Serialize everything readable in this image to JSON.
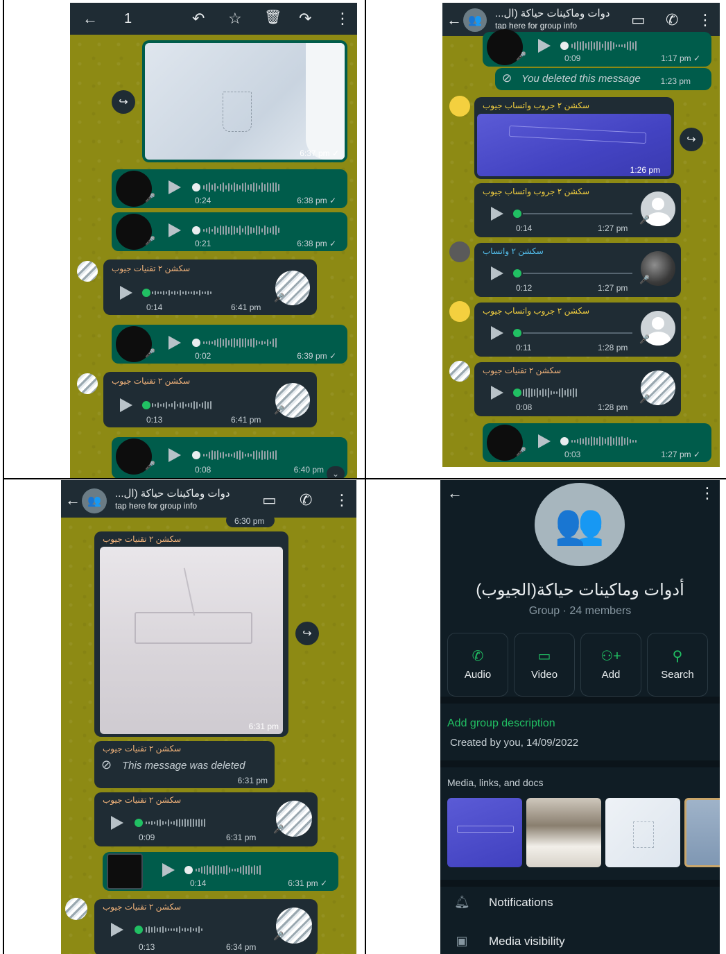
{
  "p1": {
    "toolbar": {
      "count": "1",
      "back_icon": "arrow-left-icon",
      "reply_icon": "reply-icon",
      "star_icon": "star-icon",
      "delete_icon": "trash-icon",
      "forward_icon": "forward-icon",
      "menu_icon": "more-vert-icon"
    },
    "messages": [
      {
        "kind": "image",
        "time": "6:37 pm ✓"
      },
      {
        "kind": "voice",
        "dir": "out",
        "duration": "0:24",
        "time": "6:38 pm ✓"
      },
      {
        "kind": "voice",
        "dir": "out",
        "duration": "0:21",
        "time": "6:38 pm ✓"
      },
      {
        "kind": "voice",
        "dir": "in",
        "sender": "سكشن ٢ تقنيات جيوب",
        "duration": "0:14",
        "time": "6:41 pm"
      },
      {
        "kind": "voice",
        "dir": "out",
        "duration": "0:02",
        "time": "6:39 pm ✓"
      },
      {
        "kind": "voice",
        "dir": "in",
        "sender": "سكشن ٢ تقنيات جيوب",
        "duration": "0:13",
        "time": "6:41 pm"
      },
      {
        "kind": "voice",
        "dir": "out",
        "duration": "0:08",
        "time": "6:40 pm"
      }
    ]
  },
  "p2": {
    "header": {
      "title": "دوات وماكينات حياكة (ال...",
      "subtitle": "tap here for group info"
    },
    "messages": [
      {
        "kind": "voice",
        "dir": "out",
        "duration": "0:09",
        "time": "1:17 pm ✓"
      },
      {
        "kind": "deleted",
        "text": "You deleted this message",
        "time": "1:23 pm"
      },
      {
        "kind": "image",
        "sender": "سكشن ٢ جروب واتساب جيوب",
        "time": "1:26 pm"
      },
      {
        "kind": "voice",
        "dir": "in",
        "sender": "سكشن ٢ جروب واتساب جيوب",
        "duration": "0:14",
        "time": "1:27 pm"
      },
      {
        "kind": "voice",
        "dir": "in",
        "sender": "سكشن ٢ واتساب",
        "duration": "0:12",
        "time": "1:27 pm"
      },
      {
        "kind": "voice",
        "dir": "in",
        "sender": "سكشن ٢ جروب واتساب جيوب",
        "duration": "0:11",
        "time": "1:28 pm"
      },
      {
        "kind": "voice",
        "dir": "in",
        "sender": "سكشن ٢ تقنيات جيوب",
        "duration": "0:08",
        "time": "1:28 pm"
      },
      {
        "kind": "voice",
        "dir": "out",
        "duration": "0:03",
        "time": "1:27 pm ✓"
      }
    ]
  },
  "p3": {
    "header": {
      "title": "دوات وماكينات حياكة (ال...",
      "subtitle": "tap here for group info",
      "top_time": "6:30 pm"
    },
    "messages": [
      {
        "kind": "image",
        "sender": "سكشن ٢ تقنيات جيوب",
        "time": "6:31 pm"
      },
      {
        "kind": "deleted",
        "sender": "سكشن ٢ تقنيات جيوب",
        "text": "This message was deleted",
        "time": "6:31 pm"
      },
      {
        "kind": "voice",
        "dir": "in",
        "sender": "سكشن ٢ تقنيات جيوب",
        "duration": "0:09",
        "time": "6:31 pm"
      },
      {
        "kind": "voice",
        "dir": "out",
        "duration": "0:14",
        "time": "6:31 pm ✓"
      },
      {
        "kind": "voice",
        "dir": "in",
        "sender": "سكشن ٢ تقنيات جيوب",
        "duration": "0:13",
        "time": "6:34 pm"
      }
    ]
  },
  "p4": {
    "group_name": "أدوات وماكينات حياكة(الجيوب)",
    "group_meta": "Group · 24 members",
    "actions": [
      {
        "label": "Audio",
        "icon": "phone-icon"
      },
      {
        "label": "Video",
        "icon": "video-icon"
      },
      {
        "label": "Add",
        "icon": "add-person-icon"
      },
      {
        "label": "Search",
        "icon": "search-icon"
      }
    ],
    "add_description": "Add group description",
    "created_by": "Created by you, 14/09/2022",
    "media_label": "Media, links, and docs",
    "notifications": "Notifications",
    "media_visibility": "Media visibility"
  },
  "colors": {
    "chat_bg": "#8d8a14",
    "out_bubble": "#005c4b",
    "in_bubble": "#1f2c34",
    "accent": "#21c063",
    "header": "#1f2c34",
    "info_bg": "#101d25"
  }
}
